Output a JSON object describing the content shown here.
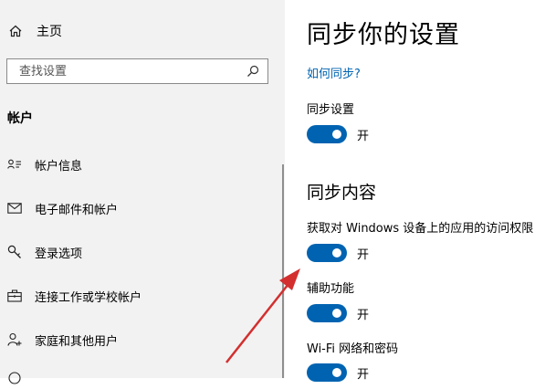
{
  "sidebar": {
    "home_label": "主页",
    "search_placeholder": "查找设置",
    "section_title": "帐户",
    "items": [
      {
        "label": "帐户信息",
        "icon": "person-card-icon"
      },
      {
        "label": "电子邮件和帐户",
        "icon": "mail-icon"
      },
      {
        "label": "登录选项",
        "icon": "key-icon"
      },
      {
        "label": "连接工作或学校帐户",
        "icon": "briefcase-icon"
      },
      {
        "label": "家庭和其他用户",
        "icon": "person-add-icon"
      }
    ]
  },
  "main": {
    "title": "同步你的设置",
    "how_link": "如何同步?",
    "sync_settings_label": "同步设置",
    "sync_settings_state": "开",
    "sync_content_heading": "同步内容",
    "options": [
      {
        "label": "获取对 Windows 设备上的应用的访问权限",
        "state": "开"
      },
      {
        "label": "辅助功能",
        "state": "开"
      },
      {
        "label": "Wi-Fi 网络和密码",
        "state": "开"
      }
    ]
  },
  "colors": {
    "accent": "#0063b1",
    "sidebar_bg": "#f2f2f2",
    "annotation_arrow": "#d32f2f"
  }
}
